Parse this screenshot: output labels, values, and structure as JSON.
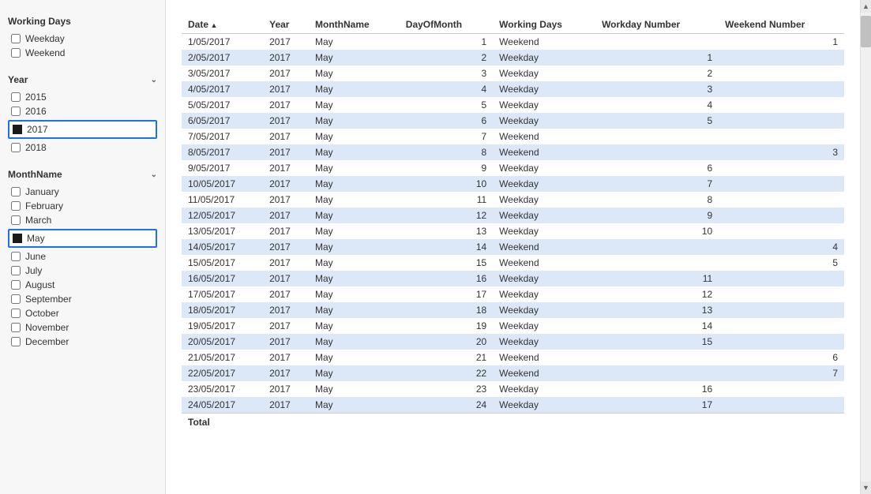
{
  "sidebar": {
    "sections": [
      {
        "id": "working-days",
        "title": "Working Days",
        "has_chevron": false,
        "items": [
          {
            "id": "weekday",
            "label": "Weekday",
            "checked": false,
            "selected": false
          },
          {
            "id": "weekend",
            "label": "Weekend",
            "checked": false,
            "selected": false
          }
        ]
      },
      {
        "id": "year",
        "title": "Year",
        "has_chevron": true,
        "items": [
          {
            "id": "2015",
            "label": "2015",
            "checked": false,
            "selected": false
          },
          {
            "id": "2016",
            "label": "2016",
            "checked": false,
            "selected": false
          },
          {
            "id": "2017",
            "label": "2017",
            "checked": true,
            "selected": true
          },
          {
            "id": "2018",
            "label": "2018",
            "checked": false,
            "selected": false
          }
        ]
      },
      {
        "id": "monthname",
        "title": "MonthName",
        "has_chevron": true,
        "items": [
          {
            "id": "january",
            "label": "January",
            "checked": false,
            "selected": false
          },
          {
            "id": "february",
            "label": "February",
            "checked": false,
            "selected": false
          },
          {
            "id": "march",
            "label": "March",
            "checked": false,
            "selected": false
          },
          {
            "id": "may",
            "label": "May",
            "checked": true,
            "selected": true
          },
          {
            "id": "june",
            "label": "June",
            "checked": false,
            "selected": false
          },
          {
            "id": "july",
            "label": "July",
            "checked": false,
            "selected": false
          },
          {
            "id": "august",
            "label": "August",
            "checked": false,
            "selected": false
          },
          {
            "id": "september",
            "label": "September",
            "checked": false,
            "selected": false
          },
          {
            "id": "october",
            "label": "October",
            "checked": false,
            "selected": false
          },
          {
            "id": "november",
            "label": "November",
            "checked": false,
            "selected": false
          },
          {
            "id": "december",
            "label": "December",
            "checked": false,
            "selected": false
          }
        ]
      }
    ]
  },
  "table": {
    "columns": [
      {
        "id": "date",
        "label": "Date",
        "sorted": "asc"
      },
      {
        "id": "year",
        "label": "Year"
      },
      {
        "id": "monthname",
        "label": "MonthName"
      },
      {
        "id": "dayofmonth",
        "label": "DayOfMonth"
      },
      {
        "id": "workingdays",
        "label": "Working Days"
      },
      {
        "id": "workdaynumber",
        "label": "Workday Number"
      },
      {
        "id": "weekendnumber",
        "label": "Weekend Number"
      }
    ],
    "rows": [
      {
        "date": "1/05/2017",
        "year": "2017",
        "month": "May",
        "day": "1",
        "workingdays": "Weekend",
        "workdaynumber": "",
        "weekendnumber": "1",
        "highlight": false
      },
      {
        "date": "2/05/2017",
        "year": "2017",
        "month": "May",
        "day": "2",
        "workingdays": "Weekday",
        "workdaynumber": "1",
        "weekendnumber": "",
        "highlight": true
      },
      {
        "date": "3/05/2017",
        "year": "2017",
        "month": "May",
        "day": "3",
        "workingdays": "Weekday",
        "workdaynumber": "2",
        "weekendnumber": "",
        "highlight": false
      },
      {
        "date": "4/05/2017",
        "year": "2017",
        "month": "May",
        "day": "4",
        "workingdays": "Weekday",
        "workdaynumber": "3",
        "weekendnumber": "",
        "highlight": true
      },
      {
        "date": "5/05/2017",
        "year": "2017",
        "month": "May",
        "day": "5",
        "workingdays": "Weekday",
        "workdaynumber": "4",
        "weekendnumber": "",
        "highlight": false
      },
      {
        "date": "6/05/2017",
        "year": "2017",
        "month": "May",
        "day": "6",
        "workingdays": "Weekday",
        "workdaynumber": "5",
        "weekendnumber": "",
        "highlight": true
      },
      {
        "date": "7/05/2017",
        "year": "2017",
        "month": "May",
        "day": "7",
        "workingdays": "Weekend",
        "workdaynumber": "",
        "weekendnumber": "",
        "highlight": false
      },
      {
        "date": "8/05/2017",
        "year": "2017",
        "month": "May",
        "day": "8",
        "workingdays": "Weekend",
        "workdaynumber": "",
        "weekendnumber": "3",
        "highlight": true
      },
      {
        "date": "9/05/2017",
        "year": "2017",
        "month": "May",
        "day": "9",
        "workingdays": "Weekday",
        "workdaynumber": "6",
        "weekendnumber": "",
        "highlight": false
      },
      {
        "date": "10/05/2017",
        "year": "2017",
        "month": "May",
        "day": "10",
        "workingdays": "Weekday",
        "workdaynumber": "7",
        "weekendnumber": "",
        "highlight": true
      },
      {
        "date": "11/05/2017",
        "year": "2017",
        "month": "May",
        "day": "11",
        "workingdays": "Weekday",
        "workdaynumber": "8",
        "weekendnumber": "",
        "highlight": false
      },
      {
        "date": "12/05/2017",
        "year": "2017",
        "month": "May",
        "day": "12",
        "workingdays": "Weekday",
        "workdaynumber": "9",
        "weekendnumber": "",
        "highlight": true
      },
      {
        "date": "13/05/2017",
        "year": "2017",
        "month": "May",
        "day": "13",
        "workingdays": "Weekday",
        "workdaynumber": "10",
        "weekendnumber": "",
        "highlight": false
      },
      {
        "date": "14/05/2017",
        "year": "2017",
        "month": "May",
        "day": "14",
        "workingdays": "Weekend",
        "workdaynumber": "",
        "weekendnumber": "4",
        "highlight": true
      },
      {
        "date": "15/05/2017",
        "year": "2017",
        "month": "May",
        "day": "15",
        "workingdays": "Weekend",
        "workdaynumber": "",
        "weekendnumber": "5",
        "highlight": false
      },
      {
        "date": "16/05/2017",
        "year": "2017",
        "month": "May",
        "day": "16",
        "workingdays": "Weekday",
        "workdaynumber": "11",
        "weekendnumber": "",
        "highlight": true
      },
      {
        "date": "17/05/2017",
        "year": "2017",
        "month": "May",
        "day": "17",
        "workingdays": "Weekday",
        "workdaynumber": "12",
        "weekendnumber": "",
        "highlight": false
      },
      {
        "date": "18/05/2017",
        "year": "2017",
        "month": "May",
        "day": "18",
        "workingdays": "Weekday",
        "workdaynumber": "13",
        "weekendnumber": "",
        "highlight": true
      },
      {
        "date": "19/05/2017",
        "year": "2017",
        "month": "May",
        "day": "19",
        "workingdays": "Weekday",
        "workdaynumber": "14",
        "weekendnumber": "",
        "highlight": false
      },
      {
        "date": "20/05/2017",
        "year": "2017",
        "month": "May",
        "day": "20",
        "workingdays": "Weekday",
        "workdaynumber": "15",
        "weekendnumber": "",
        "highlight": true
      },
      {
        "date": "21/05/2017",
        "year": "2017",
        "month": "May",
        "day": "21",
        "workingdays": "Weekend",
        "workdaynumber": "",
        "weekendnumber": "6",
        "highlight": false
      },
      {
        "date": "22/05/2017",
        "year": "2017",
        "month": "May",
        "day": "22",
        "workingdays": "Weekend",
        "workdaynumber": "",
        "weekendnumber": "7",
        "highlight": true
      },
      {
        "date": "23/05/2017",
        "year": "2017",
        "month": "May",
        "day": "23",
        "workingdays": "Weekday",
        "workdaynumber": "16",
        "weekendnumber": "",
        "highlight": false
      },
      {
        "date": "24/05/2017",
        "year": "2017",
        "month": "May",
        "day": "24",
        "workingdays": "Weekday",
        "workdaynumber": "17",
        "weekendnumber": "",
        "highlight": true
      }
    ],
    "footer_label": "Total"
  }
}
